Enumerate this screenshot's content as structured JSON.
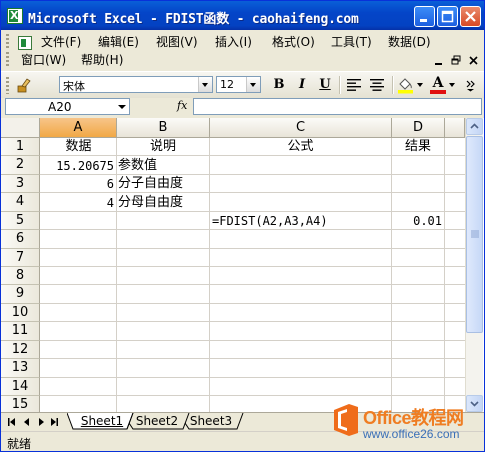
{
  "window": {
    "title": "Microsoft Excel - FDIST函数 - caohaifeng.com"
  },
  "menu": {
    "items": [
      "文件(F)",
      "编辑(E)",
      "视图(V)",
      "插入(I)",
      "格式(O)",
      "工具(T)",
      "数据(D)",
      "窗口(W)",
      "帮助(H)"
    ]
  },
  "toolbar": {
    "font_name": "宋体",
    "font_size": "12",
    "bold": "B",
    "italic": "I",
    "underline": "U",
    "font_color_letter": "A"
  },
  "formula_bar": {
    "name_box": "A20",
    "fx_label": "fx",
    "formula": ""
  },
  "sheet": {
    "columns": [
      "A",
      "B",
      "C",
      "D"
    ],
    "rows": [
      "1",
      "2",
      "3",
      "4",
      "5",
      "6",
      "7",
      "8",
      "9",
      "10",
      "11",
      "12",
      "13",
      "14",
      "15"
    ],
    "cells": {
      "A1": "数据",
      "B1": "说明",
      "C1": "公式",
      "D1": "结果",
      "A2": "15.20675",
      "B2": "参数值",
      "A3": "6",
      "B3": "分子自由度",
      "A4": "4",
      "B4": "分母自由度",
      "C5": "=FDIST(A2,A3,A4)",
      "D5": "0.01"
    }
  },
  "tabs": [
    "Sheet1",
    "Sheet2",
    "Sheet3"
  ],
  "status": {
    "text": "就绪"
  },
  "watermark": {
    "line1": "Office教程网",
    "line2": "www.office26.com"
  },
  "colors": {
    "title_bar": "#0445c8",
    "selected_header": "#f1a845",
    "watermark_orange": "#ef7d22"
  }
}
